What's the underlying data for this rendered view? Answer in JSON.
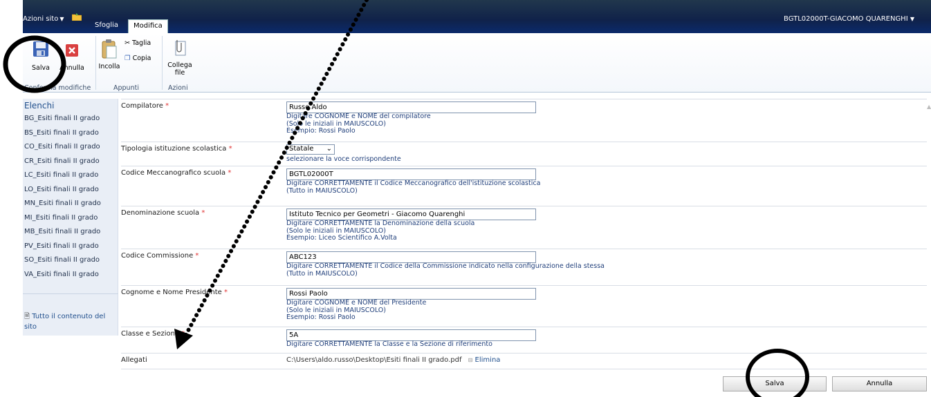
{
  "topbar": {
    "site_actions": "Azioni sito",
    "tabs": [
      "Sfoglia",
      "Modifica"
    ],
    "user": "BGTL02000T-GIACOMO QUARENGHI"
  },
  "ribbon": {
    "save": "Salva",
    "cancel": "Annulla",
    "paste": "Incolla",
    "cut": "Taglia",
    "copy": "Copia",
    "attach_line1": "Collega",
    "attach_line2": "file",
    "groups": [
      "Conferma modifiche",
      "Appunti",
      "Azioni"
    ]
  },
  "leftnav": {
    "title": "Elenchi",
    "items": [
      "BG_Esiti finali II grado",
      "BS_Esiti finali II grado",
      "CO_Esiti finali II grado",
      "CR_Esiti finali II grado",
      "LC_Esiti finali II grado",
      "LO_Esiti finali II grado",
      "MN_Esiti finali II grado",
      "MI_Esiti finali II grado",
      "MB_Esiti finali II grado",
      "PV_Esiti finali II grado",
      "SO_Esiti finali II grado",
      "VA_Esiti finali II grado"
    ],
    "all_content": "Tutto il contenuto del sito"
  },
  "form": {
    "compilatore": {
      "label": "Compilatore",
      "value": "Russo Aldo",
      "desc": [
        "Digitare COGNOME e NOME del compilatore",
        "(Solo le iniziali in MAIUSCOLO)",
        "Esempio: Rossi Paolo"
      ]
    },
    "tipologia": {
      "label": "Tipologia istituzione scolastica",
      "value": "Statale",
      "desc": [
        "selezionare la voce corrispondente"
      ]
    },
    "codice_mecc": {
      "label": "Codice Meccanografico scuola",
      "value": "BGTL02000T",
      "desc": [
        "Digitare CORRETTAMENTE il Codice Meccanografico dell'istituzione scolastica",
        "(Tutto in MAIUSCOLO)"
      ]
    },
    "denominazione": {
      "label": "Denominazione scuola",
      "value": "Istituto Tecnico per Geometri - Giacomo Quarenghi",
      "desc": [
        "Digitare CORRETTAMENTE la Denominazione della scuola",
        "(Solo le iniziali in MAIUSCOLO)",
        "Esempio: Liceo Scientifico A.Volta"
      ]
    },
    "commissione": {
      "label": "Codice Commissione",
      "value": "ABC123",
      "desc": [
        "Digitare CORRETTAMENTE il Codice della Commissione indicato nella configurazione della stessa",
        "(Tutto in MAIUSCOLO)"
      ]
    },
    "presidente": {
      "label": "Cognome e Nome Presidente",
      "value": "Rossi Paolo",
      "desc": [
        "Digitare COGNOME e NOME del Presidente",
        "(Solo le iniziali in MAIUSCOLO)",
        "Esempio: Rossi Paolo"
      ]
    },
    "classe": {
      "label": "Classe e Sezione",
      "value": "5A",
      "desc": [
        "Digitare CORRETTAMENTE la Classe e la Sezione di riferimento"
      ]
    },
    "allegati": {
      "label": "Allegati",
      "file": "C:\\Users\\aldo.russo\\Desktop\\Esiti finali II grado.pdf",
      "delete": "Elimina"
    },
    "required_mark": "*"
  },
  "buttons": {
    "save": "Salva",
    "cancel": "Annulla"
  }
}
